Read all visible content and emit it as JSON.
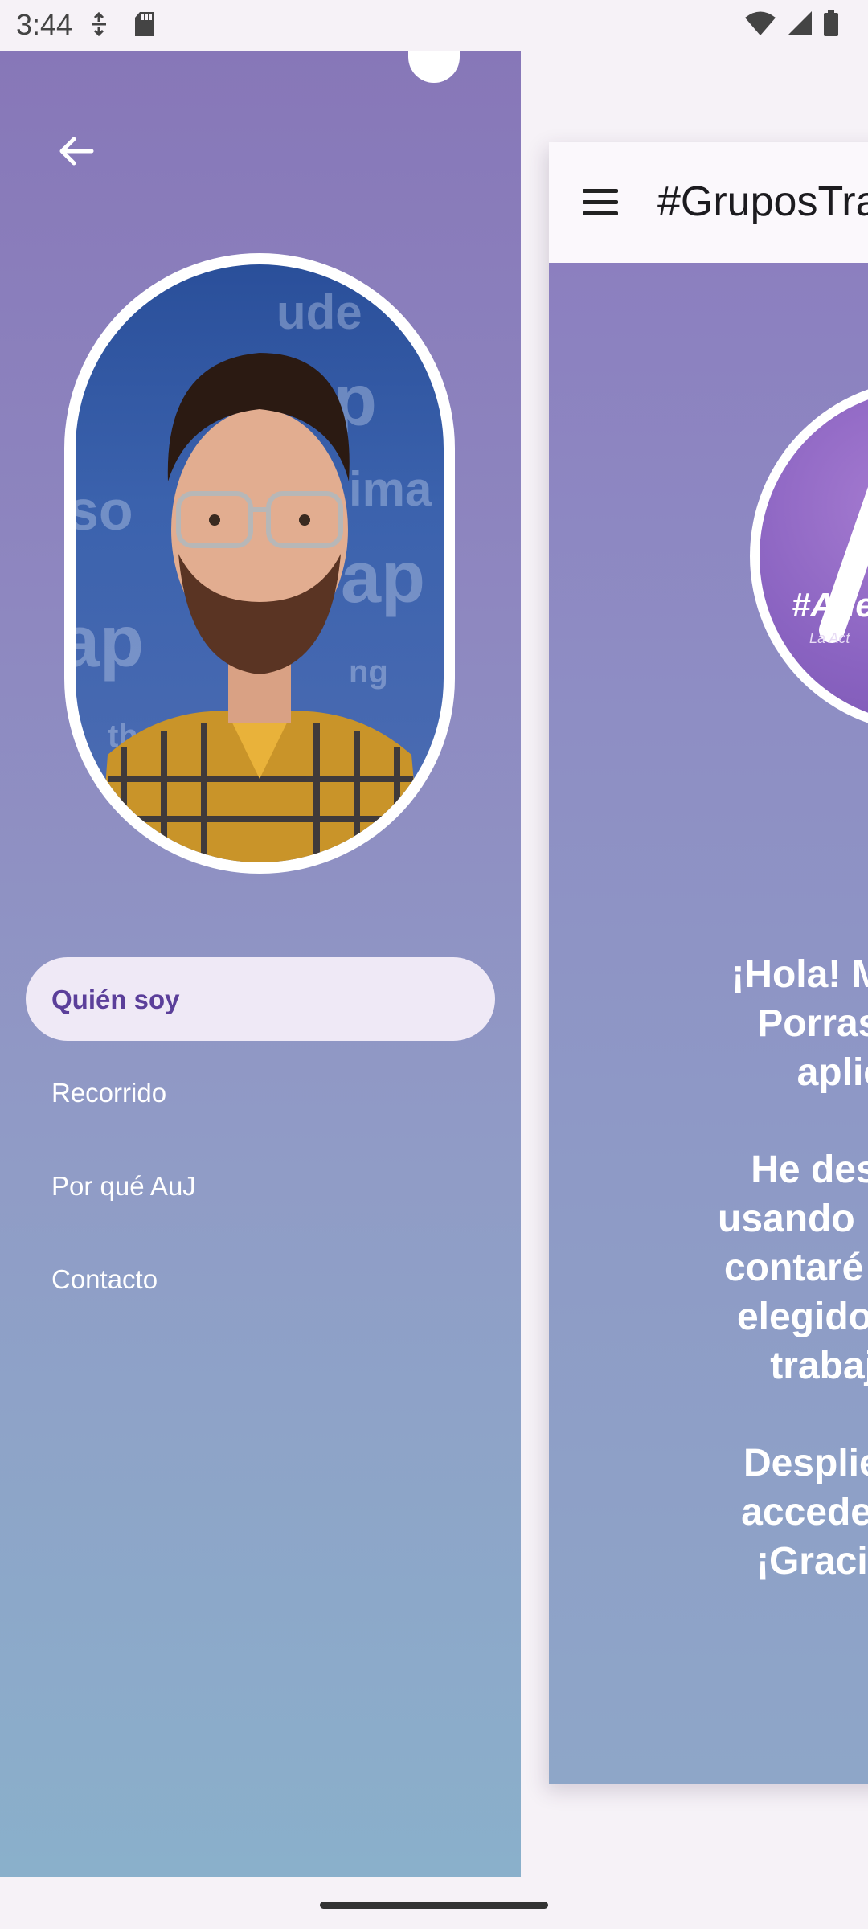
{
  "status_bar": {
    "time": "3:44"
  },
  "app_bar": {
    "title": "#GruposTra"
  },
  "logo": {
    "text": "#Ade",
    "subtext": "La Act"
  },
  "intro": {
    "paragraphs": [
      "¡Hola! Me llam\nPorras y so\naplicac",
      "He desarroll\nusando Kotlin y\ncontaré de dón\nelegido partic\ntrabajo de",
      "Despliegue e\nacceder a las\n¡Gracias po"
    ]
  },
  "drawer": {
    "nav": [
      {
        "label": "Quién soy",
        "active": true
      },
      {
        "label": "Recorrido",
        "active": false
      },
      {
        "label": "Por qué AuJ",
        "active": false
      },
      {
        "label": "Contacto",
        "active": false
      }
    ]
  },
  "colors": {
    "accent": "#5b3f9a",
    "active_pill": "#efe9f6"
  },
  "icons": [
    "back-arrow-icon",
    "menu-icon",
    "wifi-icon",
    "signal-icon",
    "battery-icon",
    "sd-card-icon",
    "data-saver-icon"
  ]
}
